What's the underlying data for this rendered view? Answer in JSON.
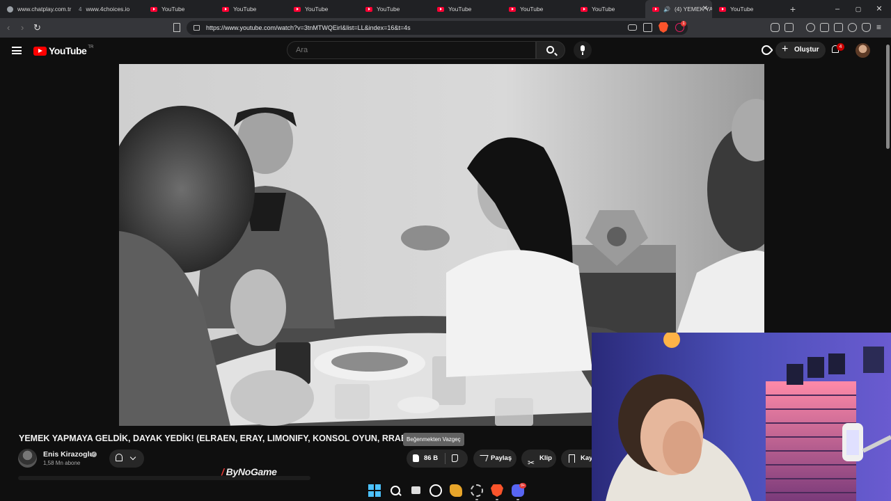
{
  "browser": {
    "tabs": [
      {
        "icon": "globe-icon",
        "label": "www.chatplay.com.tr"
      },
      {
        "icon": "number-icon",
        "prefix": "4",
        "label": "www.4choices.io"
      },
      {
        "icon": "youtube-icon",
        "label": "YouTube"
      },
      {
        "icon": "youtube-icon",
        "label": "YouTube"
      },
      {
        "icon": "youtube-icon",
        "label": "YouTube"
      },
      {
        "icon": "youtube-icon",
        "label": "YouTube"
      },
      {
        "icon": "youtube-icon",
        "label": "YouTube"
      },
      {
        "icon": "youtube-icon",
        "label": "YouTube"
      },
      {
        "icon": "youtube-icon",
        "label": "YouTube"
      },
      {
        "icon": "youtube-icon",
        "label": "(4) YEMEK YAPMAYA",
        "active": true
      },
      {
        "icon": "youtube-icon",
        "label": "YouTube"
      }
    ],
    "new_tab": "+",
    "window_controls": {
      "minimize": "–",
      "maximize": "▢",
      "close": "✕"
    },
    "url": "https://www.youtube.com/watch?v=3tnMTWQEirI&list=LL&index=16&t=4s",
    "extension_badge": "1"
  },
  "header": {
    "logo_text": "YouTube",
    "country_code": "TR",
    "search_placeholder": "Ara",
    "create_label": "Oluştur",
    "notification_count": "4"
  },
  "video": {
    "title": "YEMEK YAPMAYA GELDİK, DAYAK YEDİK! (ELRAEN, ERAY, LIMONIFY, KONSOL OYUN, RRAEN",
    "channel_name": "Enis Kirazoglu",
    "subscribers": "1,58 Mn abone",
    "like_count": "86 B",
    "tooltip": "Beğenmekten Vazgeç",
    "share_label": "Paylaş",
    "clip_label": "Klip",
    "save_label": "Kay"
  },
  "watermark": "ByNoGame",
  "taskbar": {
    "discord_badge": "9+"
  },
  "colors": {
    "youtube_red": "#ff0000",
    "background": "#0f0f0f",
    "pill_bg": "#272727",
    "brave_orange": "#fb542b",
    "windows_blue": "#4cc2ff"
  }
}
